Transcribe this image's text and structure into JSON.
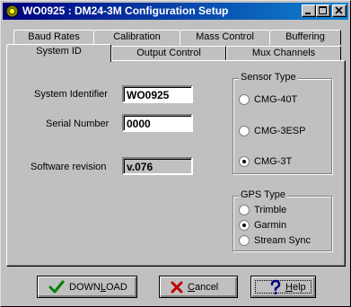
{
  "window": {
    "title": "WO0925 : DM24-3M Configuration Setup",
    "minimize_icon": "minimize-icon",
    "maximize_icon": "maximize-icon",
    "close_icon": "close-icon"
  },
  "tabs": {
    "back_row": [
      "Baud Rates",
      "Calibration",
      "Mass Control",
      "Buffering"
    ],
    "front_row": [
      "System ID",
      "Output Control",
      "Mux Channels"
    ],
    "active": "System ID"
  },
  "system_id": {
    "identifier_label": "System Identifier",
    "identifier_value": "WO0925",
    "serial_label": "Serial Number",
    "serial_value": "0000",
    "software_label": "Software revision",
    "software_value": "v.076"
  },
  "sensor_type": {
    "legend": "Sensor Type",
    "options": [
      "CMG-40T",
      "CMG-3ESP",
      "CMG-3T"
    ],
    "selected": "CMG-3T"
  },
  "gps_type": {
    "legend": "GPS Type",
    "options": [
      "Trimble",
      "Garmin",
      "Stream Sync"
    ],
    "selected": "Garmin"
  },
  "buttons": {
    "download": {
      "pre": "DOWN",
      "accel": "L",
      "post": "OAD",
      "icon": "checkmark-icon",
      "color": "#008000"
    },
    "cancel": {
      "accel": "C",
      "post": "ancel",
      "icon": "x-icon",
      "color": "#c00000"
    },
    "help": {
      "accel": "H",
      "post": "elp",
      "icon": "question-icon",
      "color": "#000080"
    }
  }
}
